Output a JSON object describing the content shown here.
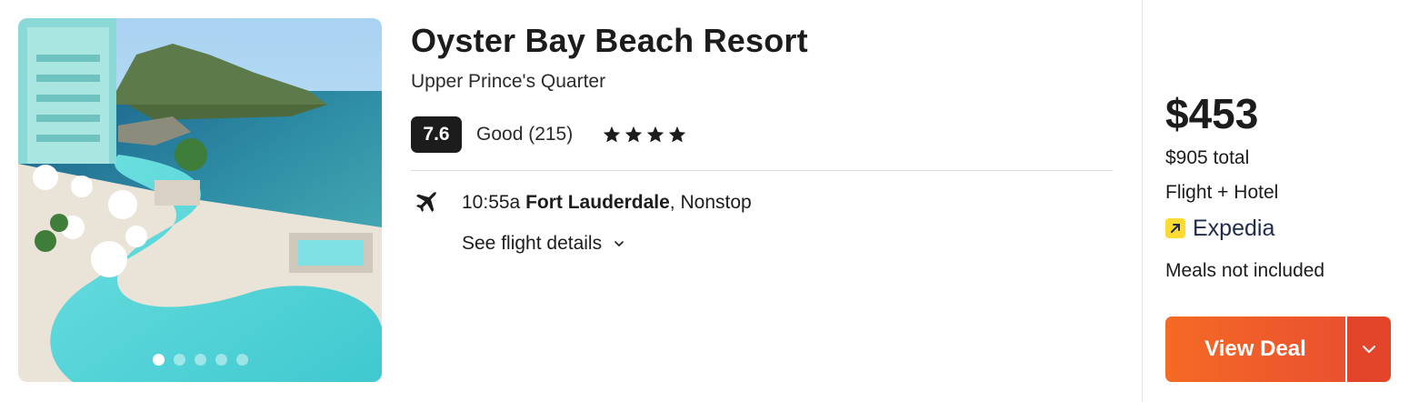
{
  "hotel": {
    "name": "Oyster Bay Beach Resort",
    "location": "Upper Prince's Quarter",
    "score": "7.6",
    "review_summary": "Good (215)",
    "stars": 4,
    "photo_count": 5,
    "active_photo_index": 0
  },
  "flight": {
    "time": "10:55a",
    "origin": "Fort Lauderdale",
    "separator": ",",
    "stops": "Nonstop",
    "details_link": "See flight details",
    "icon": "plane-icon"
  },
  "pricing": {
    "price": "$453",
    "total": "$905 total",
    "package": "Flight + Hotel",
    "provider": "Expedia",
    "meals": "Meals not included",
    "deal_button": "View Deal"
  },
  "colors": {
    "deal_gradient_start": "#f56a24",
    "deal_gradient_end": "#e9512f",
    "score_badge": "#1c1c1c",
    "provider_logo": "#fddb32"
  }
}
